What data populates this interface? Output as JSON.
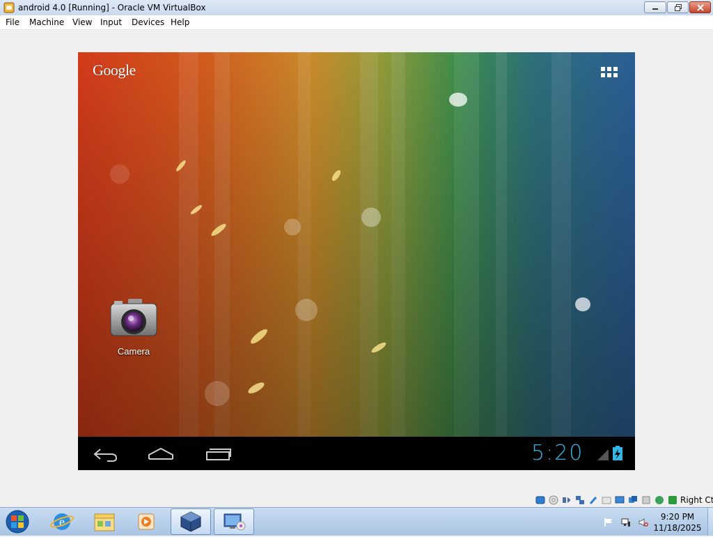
{
  "window": {
    "title": "android 4.0 [Running] - Oracle VM VirtualBox"
  },
  "menu": {
    "items": [
      "File",
      "Machine",
      "View",
      "Input",
      "Devices",
      "Help"
    ]
  },
  "android": {
    "google_label": "Google",
    "apps": [
      {
        "label": "Camera",
        "icon": "camera-icon"
      }
    ],
    "clock": "5:20",
    "accent_color": "#33b5e5",
    "nav_buttons": [
      "back-icon",
      "home-icon",
      "recent-apps-icon"
    ]
  },
  "vbox_status": {
    "host_key": "Right Ctrl"
  },
  "taskbar": {
    "time": "9:20 PM",
    "date": "11/18/2025",
    "pinned": [
      "start-orb-icon",
      "internet-explorer-icon",
      "file-explorer-icon",
      "media-player-icon",
      "virtualbox-icon",
      "vm-window-icon"
    ]
  }
}
